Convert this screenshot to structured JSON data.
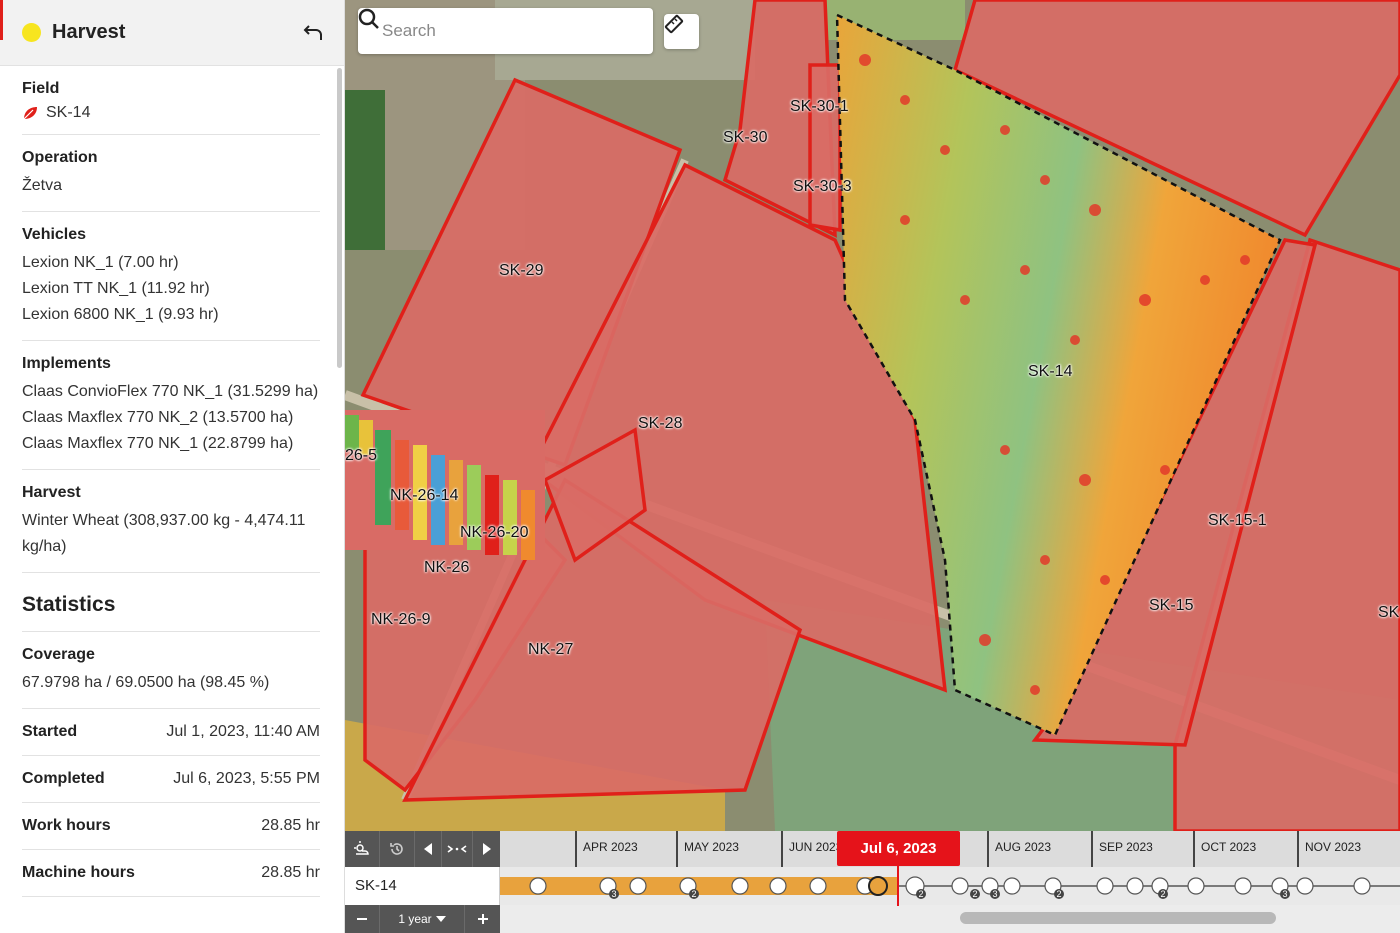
{
  "sidebar": {
    "title": "Harvest",
    "status_color": "#f7e51f",
    "field": {
      "label": "Field",
      "value": "SK-14",
      "icon": "leaf-icon"
    },
    "operation": {
      "label": "Operation",
      "value": "Žetva"
    },
    "vehicles": {
      "label": "Vehicles",
      "items": [
        "Lexion NK_1 (7.00 hr)",
        "Lexion TT NK_1 (11.92 hr)",
        "Lexion 6800 NK_1 (9.93 hr)"
      ]
    },
    "implements": {
      "label": "Implements",
      "items": [
        "Claas ConvioFlex 770 NK_1 (31.5299 ha)",
        "Claas Maxflex 770 NK_2 (13.5700 ha)",
        "Claas Maxflex 770 NK_1 (22.8799 ha)"
      ]
    },
    "harvest": {
      "label": "Harvest",
      "value": "Winter Wheat (308,937.00 kg - 4,474.11 kg/ha)"
    },
    "statistics": {
      "heading": "Statistics",
      "coverage_label": "Coverage",
      "coverage_value": "67.9798 ha / 69.0500 ha (98.45 %)",
      "rows": [
        {
          "label": "Started",
          "value": "Jul 1, 2023, 11:40 AM"
        },
        {
          "label": "Completed",
          "value": "Jul 6, 2023, 5:55 PM"
        },
        {
          "label": "Work hours",
          "value": "28.85 hr"
        },
        {
          "label": "Machine hours",
          "value": "28.85 hr"
        }
      ]
    }
  },
  "map": {
    "search_placeholder": "Search",
    "field_labels": [
      "SK-30-1",
      "SK-30",
      "SK-30-3",
      "SK-29",
      "SK-14",
      "SK-28",
      "26-5",
      "NK-26-14",
      "NK-26-20",
      "NK-26",
      "SK-15-1",
      "NK-26-9",
      "SK-15",
      "SK-",
      "NK-27"
    ]
  },
  "timeline": {
    "months": [
      "APR 2023",
      "MAY 2023",
      "JUN 2023",
      "AUG 2023",
      "SEP 2023",
      "OCT 2023",
      "NOV 2023"
    ],
    "current_date": "Jul 6, 2023",
    "track_label": "SK-14",
    "range": "1 year",
    "event_counts": [
      "3",
      "2",
      "2",
      "2",
      "3",
      "2",
      "2",
      "3"
    ],
    "accent_color": "#e5131a",
    "bar_color": "#e8a23d"
  }
}
